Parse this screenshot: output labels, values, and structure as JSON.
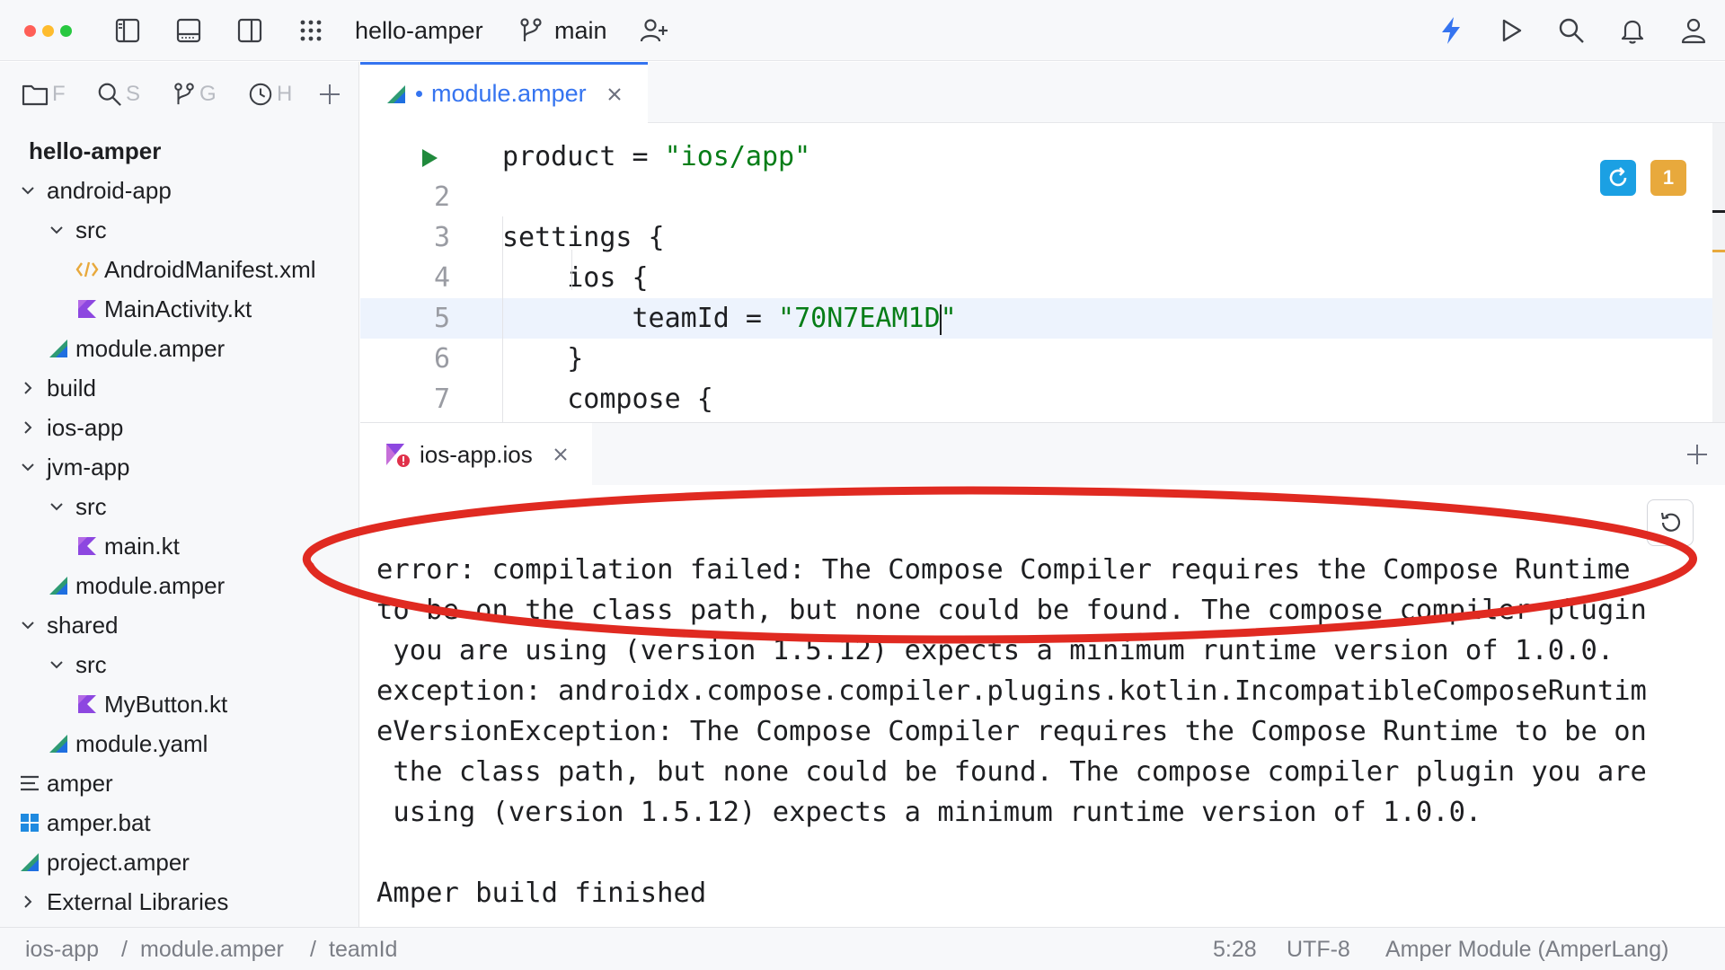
{
  "toolbar": {
    "project_name": "hello-amper",
    "branch": "main"
  },
  "sidebar": {
    "tabs": [
      "F",
      "S",
      "G",
      "H"
    ],
    "items": [
      {
        "label": "hello-amper",
        "depth": 0,
        "expandable": false,
        "icon": "none",
        "bold": true
      },
      {
        "label": "android-app",
        "depth": 0,
        "expandable": true,
        "expanded": true,
        "icon": "none"
      },
      {
        "label": "src",
        "depth": 1,
        "expandable": true,
        "expanded": true,
        "icon": "none"
      },
      {
        "label": "AndroidManifest.xml",
        "depth": 2,
        "expandable": false,
        "icon": "xml-icon"
      },
      {
        "label": "MainActivity.kt",
        "depth": 2,
        "expandable": false,
        "icon": "kotlin-icon"
      },
      {
        "label": "module.amper",
        "depth": 1,
        "expandable": false,
        "icon": "amper-icon"
      },
      {
        "label": "build",
        "depth": 0,
        "expandable": true,
        "expanded": false,
        "icon": "none"
      },
      {
        "label": "ios-app",
        "depth": 0,
        "expandable": true,
        "expanded": false,
        "icon": "none"
      },
      {
        "label": "jvm-app",
        "depth": 0,
        "expandable": true,
        "expanded": true,
        "icon": "none"
      },
      {
        "label": "src",
        "depth": 1,
        "expandable": true,
        "expanded": true,
        "icon": "none"
      },
      {
        "label": "main.kt",
        "depth": 2,
        "expandable": false,
        "icon": "kotlin-icon"
      },
      {
        "label": "module.amper",
        "depth": 1,
        "expandable": false,
        "icon": "amper-icon"
      },
      {
        "label": "shared",
        "depth": 0,
        "expandable": true,
        "expanded": true,
        "icon": "none"
      },
      {
        "label": "src",
        "depth": 1,
        "expandable": true,
        "expanded": true,
        "icon": "none"
      },
      {
        "label": "MyButton.kt",
        "depth": 2,
        "expandable": false,
        "icon": "kotlin-icon"
      },
      {
        "label": "module.yaml",
        "depth": 1,
        "expandable": false,
        "icon": "amper-icon"
      },
      {
        "label": "amper",
        "depth": 0,
        "expandable": false,
        "icon": "text-file-icon"
      },
      {
        "label": "amper.bat",
        "depth": 0,
        "expandable": false,
        "icon": "windows-icon"
      },
      {
        "label": "project.amper",
        "depth": 0,
        "expandable": false,
        "icon": "amper-icon"
      },
      {
        "label": "External Libraries",
        "depth": 0,
        "expandable": true,
        "expanded": false,
        "icon": "none"
      }
    ]
  },
  "editor": {
    "tab_label": "module.amper",
    "warning_count": "1",
    "lines": [
      {
        "num": "",
        "run_marker": true,
        "parts": [
          [
            "product = ",
            ""
          ],
          [
            "\"ios/app\"",
            "str"
          ]
        ]
      },
      {
        "num": "2",
        "parts": []
      },
      {
        "num": "3",
        "parts": [
          [
            "settings {",
            ""
          ]
        ]
      },
      {
        "num": "4",
        "parts": [
          [
            "    ios {",
            ""
          ]
        ]
      },
      {
        "num": "5",
        "current": true,
        "parts": [
          [
            "        teamId = ",
            ""
          ],
          [
            "\"70N7EAM1D",
            "str"
          ],
          [
            "|caret|",
            "caret"
          ],
          [
            "\"",
            "str"
          ]
        ]
      },
      {
        "num": "6",
        "parts": [
          [
            "    }",
            ""
          ]
        ]
      },
      {
        "num": "7",
        "parts": [
          [
            "    compose {",
            ""
          ]
        ]
      }
    ]
  },
  "run_panel": {
    "tab_label": "ios-app.ios",
    "console_lines": [
      "error: compilation failed: The Compose Compiler requires the Compose Runtime",
      "to be on the class path, but none could be found. The compose compiler plugin",
      " you are using (version 1.5.12) expects a minimum runtime version of 1.0.0.",
      "exception: androidx.compose.compiler.plugins.kotlin.IncompatibleComposeRuntim",
      "eVersionException: The Compose Compiler requires the Compose Runtime to be on",
      " the class path, but none could be found. The compose compiler plugin you are",
      " using (version 1.5.12) expects a minimum runtime version of 1.0.0.",
      "",
      "Amper build finished"
    ]
  },
  "statusbar": {
    "breadcrumb": [
      "ios-app",
      "module.amper",
      "teamId"
    ],
    "position": "5:28",
    "encoding": "UTF-8",
    "file_type": "Amper Module (AmperLang)"
  },
  "colors": {
    "accent": "#3574f0",
    "annotation_red": "#e02a21",
    "string_green": "#067d17",
    "warning_orange": "#e8a93c",
    "reload_blue": "#1ba0e3"
  }
}
